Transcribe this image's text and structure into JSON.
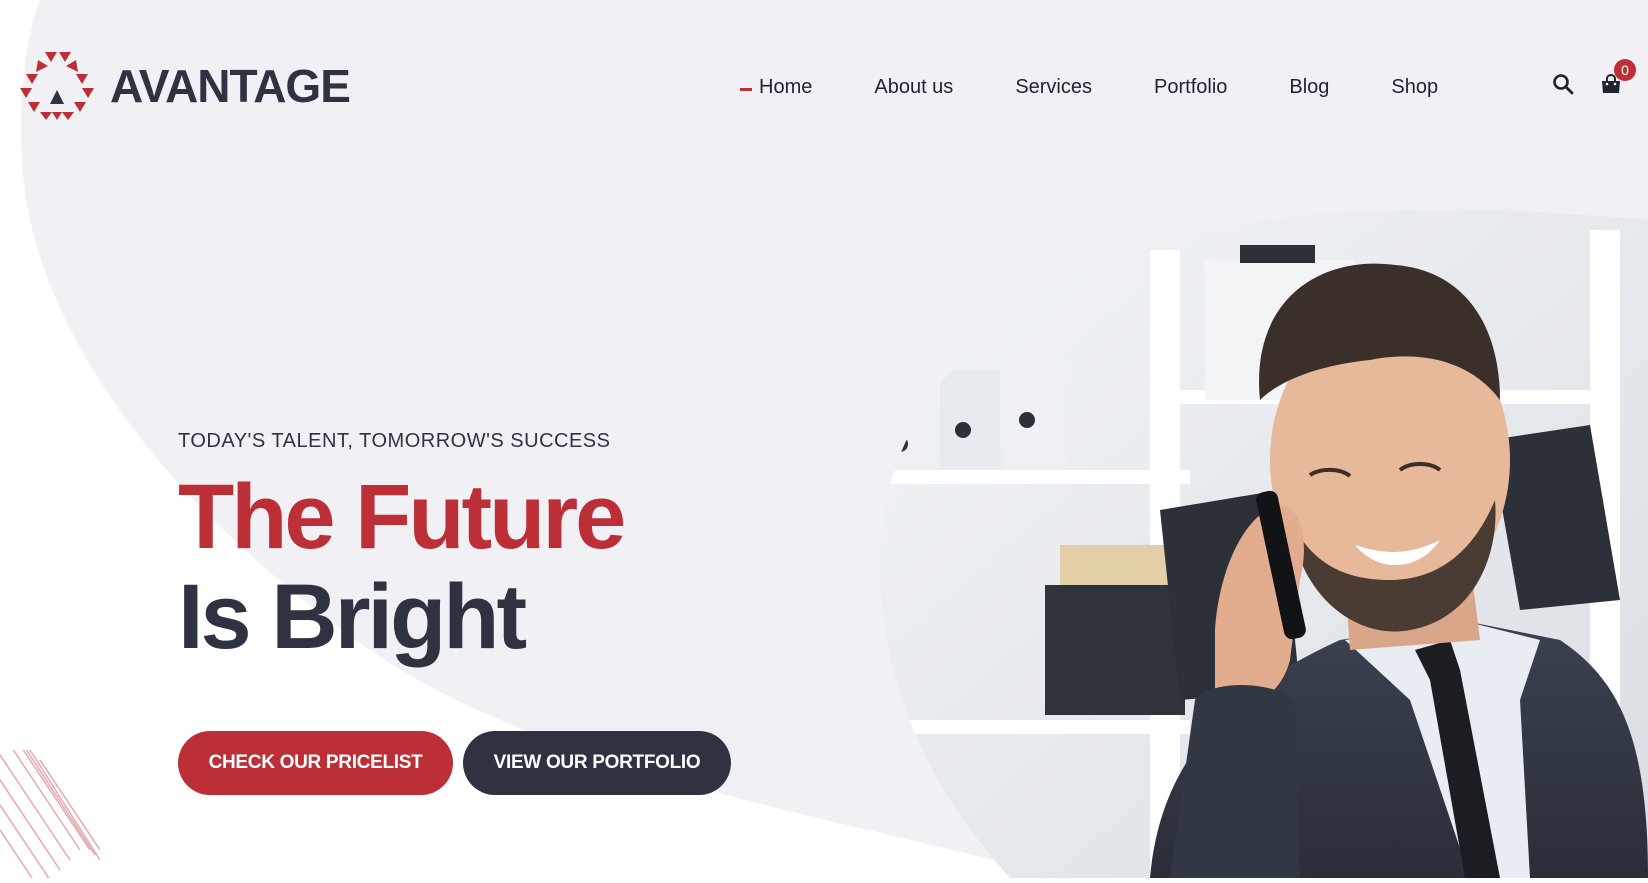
{
  "brand": {
    "name": "AVANTAGE"
  },
  "nav": {
    "items": [
      {
        "label": "Home",
        "active": true
      },
      {
        "label": "About us"
      },
      {
        "label": "Services"
      },
      {
        "label": "Portfolio"
      },
      {
        "label": "Blog"
      },
      {
        "label": "Shop"
      }
    ],
    "search_icon": "search-icon",
    "cart_icon": "shopping-bag-icon",
    "cart_count": "0"
  },
  "hero": {
    "tagline": "TODAY'S TALENT, TOMORROW'S SUCCESS",
    "headline_line1": "The Future",
    "headline_line2": "Is Bright",
    "primary_button": "CHECK OUR PRICELIST",
    "secondary_button": "VIEW OUR PORTFOLIO",
    "image": "businessman-on-phone-photo"
  },
  "colors": {
    "accent": "#bc2f36",
    "dark": "#2f3341",
    "background_blob": "#f1f0f4",
    "page": "#ffffff"
  }
}
